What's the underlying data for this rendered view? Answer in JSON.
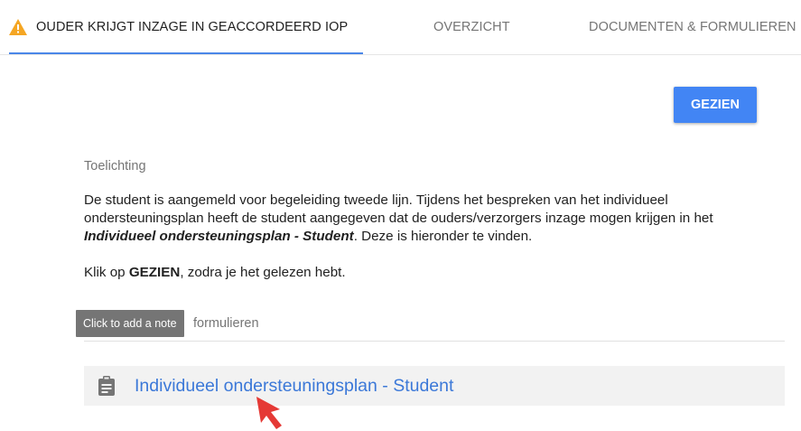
{
  "tabs": [
    {
      "label": "OUDER KRIJGT INZAGE IN GEACCORDEERD IOP",
      "active": true,
      "icon": "warning-icon"
    },
    {
      "label": "OVERZICHT",
      "active": false
    },
    {
      "label": "DOCUMENTEN & FORMULIEREN",
      "active": false
    }
  ],
  "actions": {
    "gezien_label": "GEZIEN"
  },
  "toelichting": {
    "label": "Toelichting",
    "text_intro": "De student is aangemeld voor begeleiding tweede lijn. Tijdens het bespreken van het individueel ondersteuningsplan heeft de student aangegeven dat de ouders/verzorgers inzage mogen krijgen in het ",
    "text_emph": "Individueel ondersteuningsplan - Student",
    "text_outro": ". Deze is hieronder te vinden.",
    "instruction_prefix": "Klik op ",
    "instruction_strong": "GEZIEN",
    "instruction_suffix": ", zodra je het gelezen hebt."
  },
  "documents_section": {
    "label_visible": "formulieren",
    "items": [
      {
        "title": "Individueel ondersteuningsplan - Student",
        "icon": "clipboard-icon"
      }
    ]
  },
  "tooltip": {
    "text": "Click to add a note"
  },
  "colors": {
    "accent": "#4285f4",
    "tab_indicator": "#4a86e8",
    "link": "#3b78d8",
    "warning": "#f5a623",
    "cursor": "#e53935"
  }
}
